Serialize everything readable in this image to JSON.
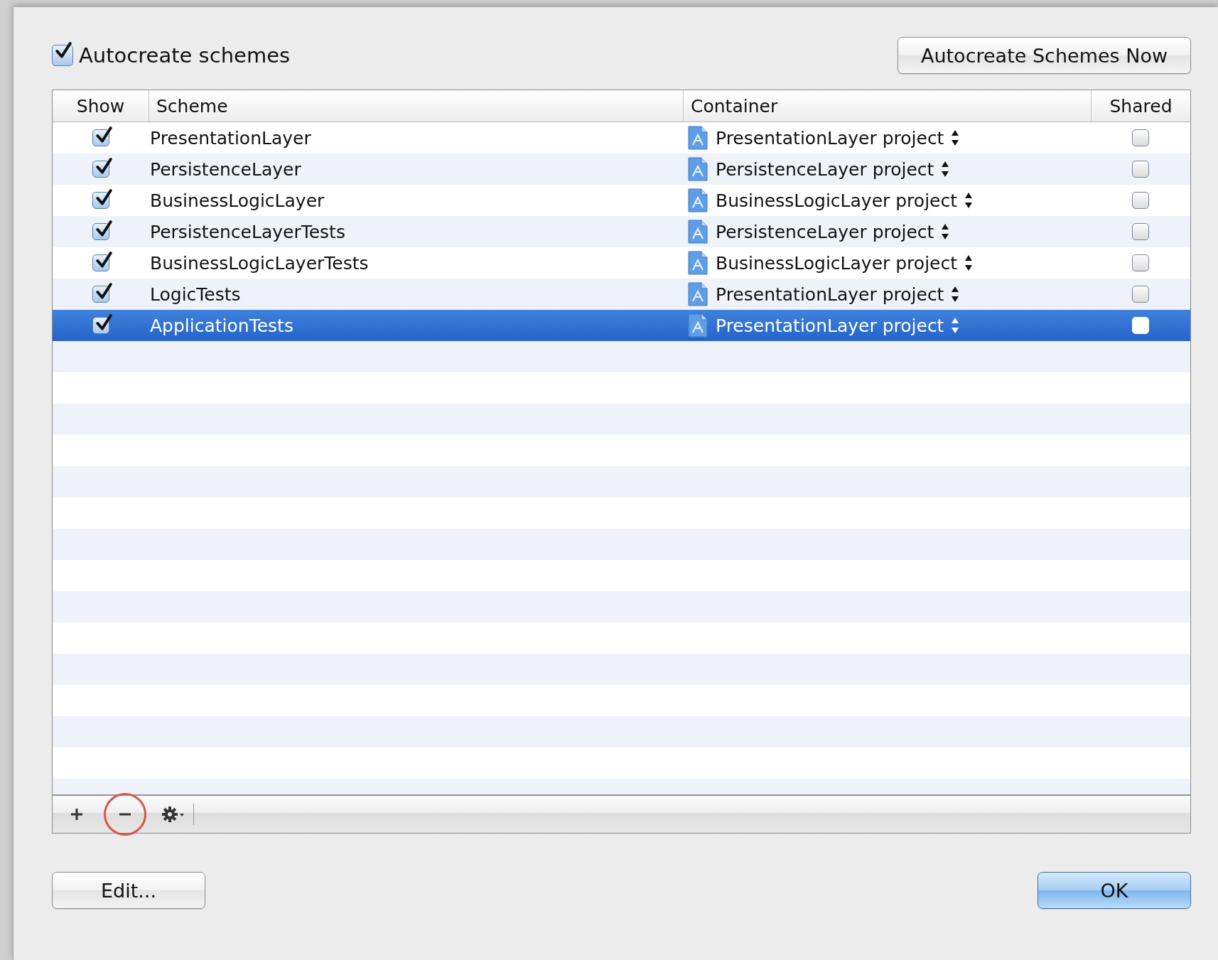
{
  "autocreate": {
    "label": "Autocreate schemes",
    "checked": true
  },
  "autocreate_now_button": "Autocreate Schemes Now",
  "table": {
    "columns": [
      "Show",
      "Scheme",
      "Container",
      "Shared"
    ],
    "rows": [
      {
        "show": true,
        "scheme": "PresentationLayer",
        "container": "PresentationLayer project",
        "shared": false,
        "selected": false
      },
      {
        "show": true,
        "scheme": "PersistenceLayer",
        "container": "PersistenceLayer project",
        "shared": false,
        "selected": false
      },
      {
        "show": true,
        "scheme": "BusinessLogicLayer",
        "container": "BusinessLogicLayer project",
        "shared": false,
        "selected": false
      },
      {
        "show": true,
        "scheme": "PersistenceLayerTests",
        "container": "PersistenceLayer project",
        "shared": false,
        "selected": false
      },
      {
        "show": true,
        "scheme": "BusinessLogicLayerTests",
        "container": "BusinessLogicLayer project",
        "shared": false,
        "selected": false
      },
      {
        "show": true,
        "scheme": "LogicTests",
        "container": "PresentationLayer project",
        "shared": false,
        "selected": false
      },
      {
        "show": true,
        "scheme": "ApplicationTests",
        "container": "PresentationLayer project",
        "shared": false,
        "selected": true
      }
    ]
  },
  "toolbar": [
    {
      "kind": "add",
      "highlighted": false
    },
    {
      "kind": "remove",
      "highlighted": true
    },
    {
      "kind": "action",
      "highlighted": false
    }
  ],
  "buttons": [
    {
      "label": "Edit...",
      "default": false
    },
    {
      "label": "OK",
      "default": true
    }
  ]
}
